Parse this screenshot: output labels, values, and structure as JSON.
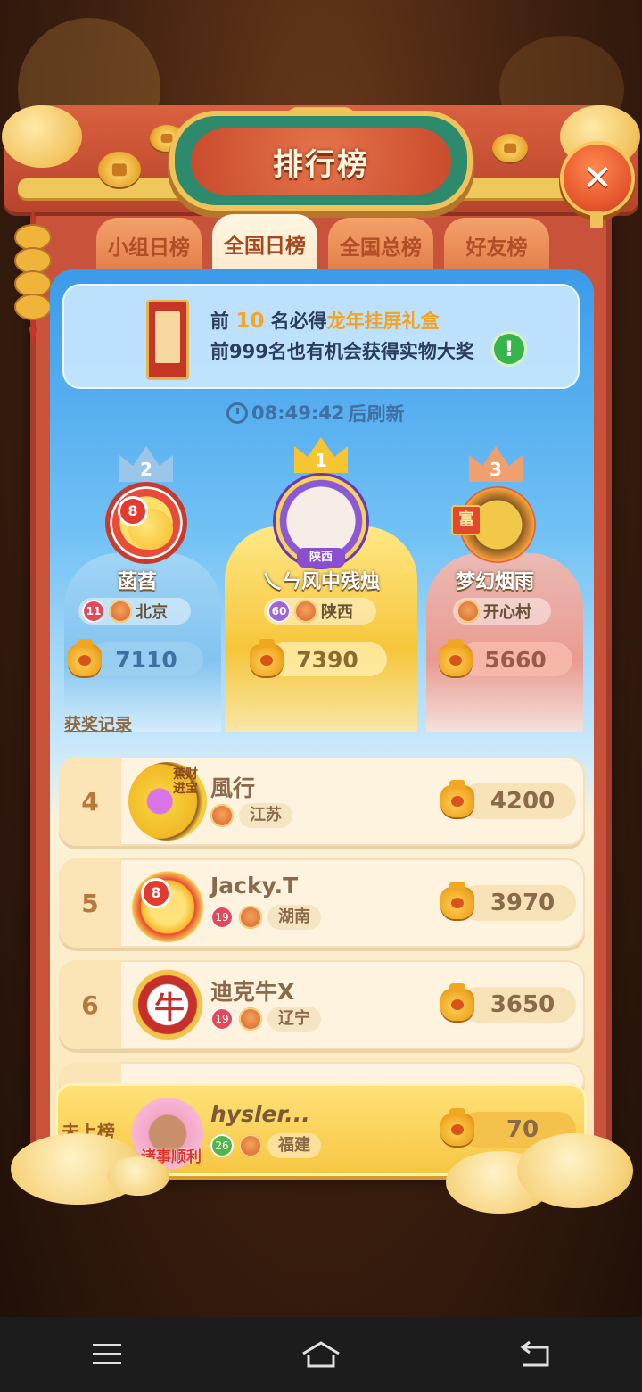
{
  "title": "排行榜",
  "tabs": [
    {
      "label": "小组日榜",
      "active": false
    },
    {
      "label": "全国日榜",
      "active": true
    },
    {
      "label": "全国总榜",
      "active": false
    },
    {
      "label": "好友榜",
      "active": false
    }
  ],
  "banner": {
    "line1_prefix": "前 ",
    "line1_num": "10",
    "line1_mid": " 名必得",
    "line1_gift": "龙年挂屏礼盒",
    "line2": "前999名也有机会获得实物大奖",
    "info_icon": "exclamation-icon"
  },
  "timer": {
    "time": "08:49:42",
    "suffix": "后刷新"
  },
  "podium": [
    {
      "rank": "2",
      "name": "菡萏",
      "level": "11",
      "region": "北京",
      "score": "7110",
      "level_badge": "8"
    },
    {
      "rank": "1",
      "name": "乀ㄣ风中残烛",
      "level": "60",
      "region": "陕西",
      "score": "7390",
      "region_tag": "陕西"
    },
    {
      "rank": "3",
      "name": "梦幻烟雨",
      "level": "",
      "region": "开心村",
      "score": "5660",
      "badge_text": "富"
    }
  ],
  "award_link": "获奖记录",
  "rows": [
    {
      "rank": "4",
      "name": "風行",
      "level": "",
      "region": "江苏",
      "score": "4200",
      "avatar_text": "蕉财进宝"
    },
    {
      "rank": "5",
      "name": "Jacky.T",
      "level": "19",
      "region": "湖南",
      "score": "3970",
      "level_badge": "8"
    },
    {
      "rank": "6",
      "name": "迪克牛X",
      "level": "19",
      "region": "辽宁",
      "score": "3650",
      "avatar_text": "牛"
    }
  ],
  "me": {
    "rank": "未上榜",
    "name": "hysler...",
    "level": "26",
    "region": "福建",
    "score": "70",
    "avatar_text": "诸事顺利"
  },
  "colors": {
    "frame": "#c9533a",
    "title_plate": "#2e8a6d",
    "gold": "#f7c531",
    "text_brown": "#8a6a4a"
  }
}
